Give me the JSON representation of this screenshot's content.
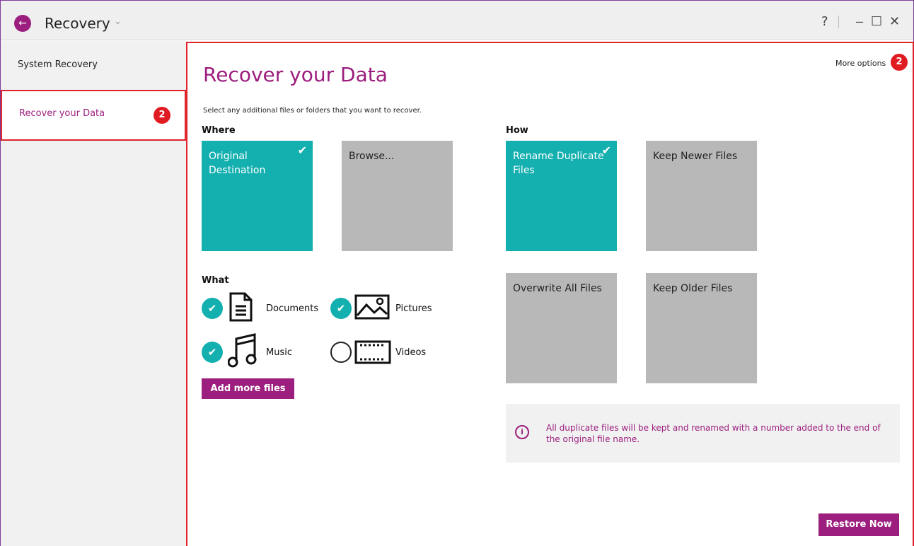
{
  "titlebar": {
    "title": "Recovery",
    "back_icon": "arrow-left-icon",
    "chevron": "⌄",
    "help": "?",
    "minimize": "—",
    "maximize": "☐",
    "close": "✕"
  },
  "sidebar": {
    "items": [
      {
        "label": "System Recovery",
        "active": false
      },
      {
        "label": "Recover your Data",
        "active": true,
        "badge": "2"
      }
    ]
  },
  "main": {
    "title": "Recover your Data",
    "subtitle": "Select any additional files or folders that you want to recover.",
    "more_options": "More options",
    "more_options_badge": "2",
    "where": {
      "label": "Where",
      "tiles": [
        {
          "label": "Original Destination",
          "selected": true
        },
        {
          "label": "Browse...",
          "selected": false
        }
      ]
    },
    "how": {
      "label": "How",
      "tiles": [
        {
          "label": "Rename Duplicate Files",
          "selected": true
        },
        {
          "label": "Keep Newer Files",
          "selected": false
        },
        {
          "label": "Overwrite All Files",
          "selected": false
        },
        {
          "label": "Keep Older Files",
          "selected": false
        }
      ]
    },
    "what": {
      "label": "What",
      "items": [
        {
          "label": "Documents",
          "checked": true,
          "icon": "document-icon"
        },
        {
          "label": "Pictures",
          "checked": true,
          "icon": "picture-icon"
        },
        {
          "label": "Music",
          "checked": true,
          "icon": "music-icon"
        },
        {
          "label": "Videos",
          "checked": false,
          "icon": "film-icon"
        }
      ]
    },
    "add_more_files": "Add more files",
    "info_text": "All duplicate files will be kept and renamed with a number added to the end of the original file name.",
    "restore_now": "Restore Now"
  },
  "colors": {
    "accent": "#9c1e7e",
    "teal": "#14afaf",
    "tile_gray": "#b8b8b8",
    "highlight_red": "#e0242c"
  }
}
